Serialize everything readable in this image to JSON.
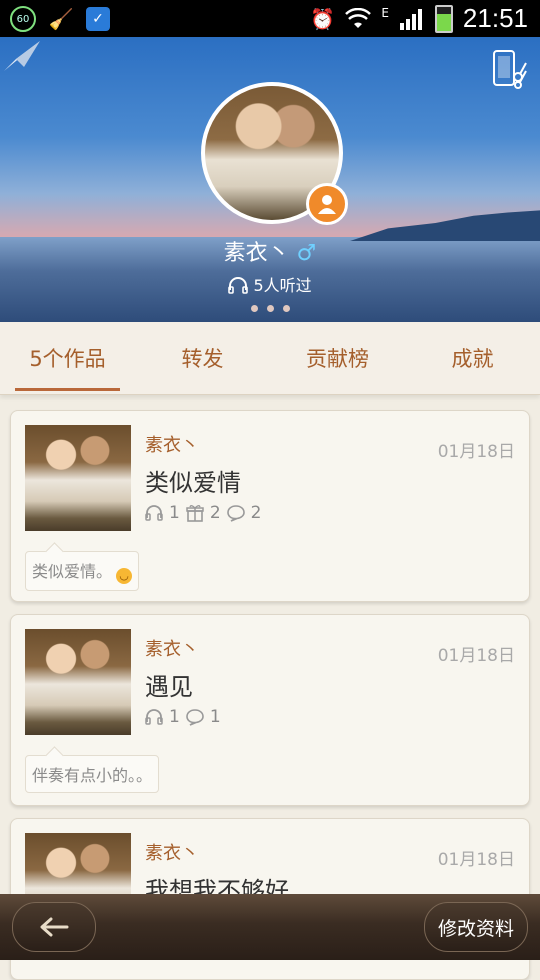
{
  "status_bar": {
    "badge": "60",
    "network": "E",
    "time": "21:51"
  },
  "profile": {
    "name": "素衣丶",
    "gender_symbol": "♂",
    "listeners": "5人听过"
  },
  "tabs": [
    {
      "label": "5个作品",
      "active": true
    },
    {
      "label": "转发",
      "active": false
    },
    {
      "label": "贡献榜",
      "active": false
    },
    {
      "label": "成就",
      "active": false
    }
  ],
  "works": [
    {
      "author": "素衣丶",
      "date": "01月18日",
      "title": "类似爱情",
      "listens": "1",
      "gifts": "2",
      "comments": "2",
      "comment_text": "类似爱情。"
    },
    {
      "author": "素衣丶",
      "date": "01月18日",
      "title": "遇见",
      "listens": "1",
      "comments": "1",
      "comment_text": "伴奏有点小的。。"
    },
    {
      "author": "素衣丶",
      "date": "01月18日",
      "title": "我想我不够好"
    }
  ],
  "bottom_bar": {
    "edit_label": "修改资料"
  },
  "colors": {
    "accent": "#a55f2c",
    "badge": "#f08a2a",
    "male": "#6fd0ff"
  }
}
